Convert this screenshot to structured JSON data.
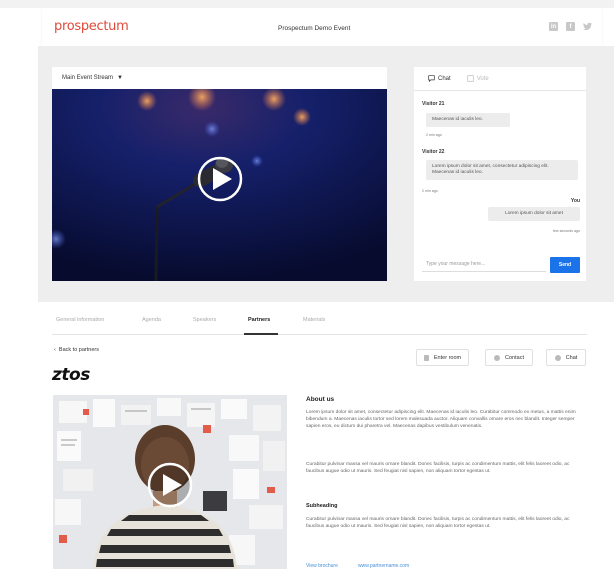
{
  "header": {
    "logo": "prospectum",
    "event_title": "Prospectum Demo Event",
    "social_icons": [
      "linkedin-icon",
      "facebook-icon",
      "twitter-icon"
    ]
  },
  "stream": {
    "selector_label": "Main Event Stream"
  },
  "chat": {
    "tabs": [
      {
        "label": "Chat",
        "active": true
      },
      {
        "label": "Vote",
        "active": false
      }
    ],
    "messages": [
      {
        "sender": "Visitor 21",
        "text": "Maecenas id iaculis leo.",
        "time": "2 min ago"
      },
      {
        "sender": "Visitor 22",
        "text": "Lorem ipsum dolor sit amet, consectetur adipiscing elit. Maecenas id iaculis leo.",
        "time": "2 min ago"
      },
      {
        "sender": "You",
        "text": "Lorem ipsum dolor sit amet",
        "time": "few seconds ago"
      }
    ],
    "input_placeholder": "Type your message here...",
    "send_label": "Send"
  },
  "tabs": [
    {
      "label": "General information",
      "active": false
    },
    {
      "label": "Agenda",
      "active": false
    },
    {
      "label": "Speakers",
      "active": false
    },
    {
      "label": "Partners",
      "active": true
    },
    {
      "label": "Materials",
      "active": false
    }
  ],
  "partner": {
    "back_label": "Back to partners",
    "logo_text": "ztos",
    "actions": {
      "enter_room": "Enter room",
      "contact": "Contact",
      "chat": "Chat"
    },
    "about_heading": "About us",
    "paragraph1": "Lorem ipsum dolor sit amet, consectetur adipiscing elit. Maecenas id iaculis leo. Curabitur commodo ex metus, a mattis enim bibendum a. Maecenas iaculis tortor sed lorem malesuada auctor. Aliquam convallis ornare eros nec blandit. Integer semper sapien eros, eu dictum dui pharetra vel. Maecenas dapibus vestibulum venenatis.",
    "paragraph2": "Curabitur pulvinar massa vel mauris ornare blandit. Donec facilisis, turpis ac condimentum mattis, elit felis laoreet odio, ac faucibus augue odio ut mauris. Sed feugiat nisl sapien, non aliquam tortor egestas ut.",
    "subheading": "Subheading",
    "paragraph3": "Curabitur pulvinar massa vel mauris ornare blandit. Donec facilisis, turpis ac condimentum mattis, elit felis laoreet odio, ac faucibus augue odio ut mauris. Sed feugiat nisl sapien, non aliquam tortor egestas ut.",
    "links": [
      "View brochure",
      "www.partnername.com"
    ]
  },
  "colors": {
    "brand": "#e04a3a",
    "accent": "#1a73e8",
    "page_bg": "#eeeeee"
  }
}
